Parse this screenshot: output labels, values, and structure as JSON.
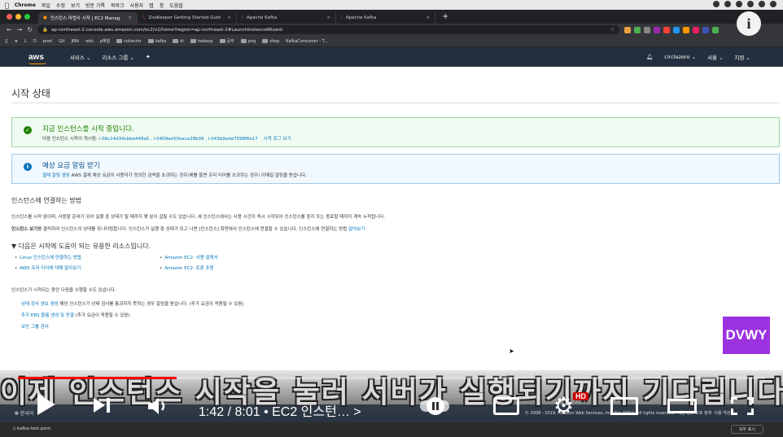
{
  "macbar": {
    "apple": "",
    "app": "Chrome",
    "menus": [
      "파일",
      "수정",
      "보기",
      "방문 기록",
      "북마크",
      "사용자",
      "탭",
      "창",
      "도움말"
    ]
  },
  "tabs": [
    {
      "label": "인스턴스 마법사 시작 | EC2 Manag",
      "active": true
    },
    {
      "label": "ZooKeeper Getting Started Guid",
      "active": false
    },
    {
      "label": "Apache Kafka",
      "active": false
    },
    {
      "label": "Apache Kafka",
      "active": false
    }
  ],
  "address": {
    "url": "ap-northeast-2.console.aws.amazon.com/ec2/v2/home?region=ap-northeast-2#LaunchInstanceWizard:"
  },
  "bookmarks": [
    "L",
    "D",
    "pnet",
    "Git",
    "JIRA",
    "wiki",
    "p해질",
    "collector",
    "kafka",
    "di",
    "hadoop",
    "공부",
    "png",
    "shop",
    "KafkaConsumer - T..."
  ],
  "awsnav": {
    "logo": "aws",
    "services": "서비스",
    "resource_groups": "리소스 그룹",
    "user": "circlezero",
    "region": "서울",
    "support": "지원"
  },
  "page": {
    "title": "시작 상태",
    "success": {
      "title": "지금 인스턴스를 시작 중입니다.",
      "desc_prefix": "다음 인스턴스 시작이 개시됨:",
      "instance_ids": "i-06c14d34cbba448a5 , i-0409ae50eaca28b09 , i-043b9eda7598f6e17",
      "log_link": "시작 로그 보기"
    },
    "info": {
      "title": "예상 요금 알림 받기",
      "desc_link": "결제 알림 생성",
      "desc_rest": "AWS 결제 예상 요금이 사용자가 정의한 금액을 초과하는 경우(예를 들면 프리 티어를 초과하는 경우) 이메일 알림을 받습니다."
    },
    "connect": {
      "heading": "인스턴스에 연결하는 방법",
      "para1": "인스턴스를 시작 중이며, 사용할 준비가 되어 실행 중 상태가 될 때까지 몇 분이 걸릴 수도 있습니다. 새 인스턴스에서는 사용 시간이 즉시 시작되어 인스턴스를 중지 또는 종료할 때까지 계속 누적됩니다.",
      "para2_bold": "인스턴스 보기",
      "para2_rest": "를 클릭하여 인스턴스의 상태를 모니터링합니다. 인스턴스가 실행 중 상태가 되고 나면 [인스턴스] 화면에서 인스턴스에 연결할 수 있습니다. 인스턴스에 연결하는 방법",
      "para2_link": "알아보기."
    },
    "helpful": {
      "heading": "▼ 다음은 시작에 도움이 되는 유용한 리소스입니다.",
      "left": [
        "Linux 인스턴스에 연결하는 방법",
        "AWS 프리 티어에 대해 알아보기"
      ],
      "right": [
        "Amazon EC2: 사용 설명서",
        "Amazon EC2: 토론 포럼"
      ]
    },
    "while_starting": "인스턴스가 시작되는 동안 다음을 수행할 수도 있습니다.",
    "actions": [
      {
        "link": "상태 검사 경보 생성",
        "rest": "해당 인스턴스가 상태 검사를 통과하지 못하는 경우 알림을 받습니다. (추가 요금이 적용될 수 있음)"
      },
      {
        "link": "추가 EBS 볼륨 생성 및 연결",
        "rest": "(추가 요금이 적용될 수 있음)"
      },
      {
        "link": "보안 그룹 관리",
        "rest": ""
      }
    ]
  },
  "footer": {
    "lang": "한국어",
    "copyright": "© 2008 - 2019, Amazon Web Services, Inc. 또는 자회사. All rights reserved.",
    "privacy": "개인 정보 보호 정책",
    "terms": "이용 약관"
  },
  "downloads": {
    "file": "kafka-test.pem",
    "show_all": "모두 표시"
  },
  "video": {
    "brand": "DVWY",
    "subtitle": "이제 인스턴스 시작을 눌러 서버가 실행되기까지 기다립니다",
    "time": "1:42 / 8:01 • EC2 인스턴… >",
    "progress": 0.212,
    "hd": "HD",
    "info_icon": "i"
  }
}
